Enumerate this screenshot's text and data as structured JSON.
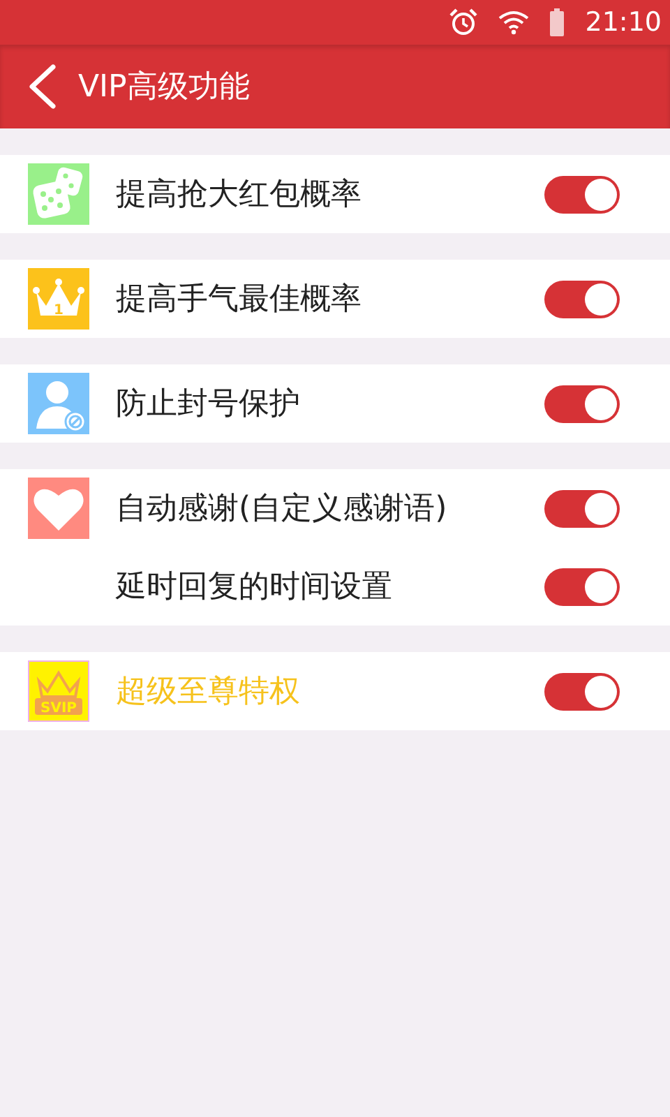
{
  "status_bar": {
    "time": "21:10"
  },
  "header": {
    "title": "VIP高级功能"
  },
  "groups": [
    {
      "kind": "dice",
      "rows": [
        {
          "label": "提高抢大红包概率",
          "highlight": false,
          "on": true
        }
      ]
    },
    {
      "kind": "crown",
      "icon_text": "1",
      "rows": [
        {
          "label": "提高手气最佳概率",
          "highlight": false,
          "on": true
        }
      ]
    },
    {
      "kind": "user-block",
      "rows": [
        {
          "label": "防止封号保护",
          "highlight": false,
          "on": true
        }
      ]
    },
    {
      "kind": "heart",
      "rows": [
        {
          "label": "自动感谢(自定义感谢语)",
          "highlight": false,
          "on": true
        },
        {
          "label": "延时回复的时间设置",
          "highlight": false,
          "on": true
        }
      ]
    },
    {
      "kind": "svip",
      "icon_text": "SVIP",
      "rows": [
        {
          "label": "超级至尊特权",
          "highlight": true,
          "on": true
        }
      ]
    }
  ]
}
